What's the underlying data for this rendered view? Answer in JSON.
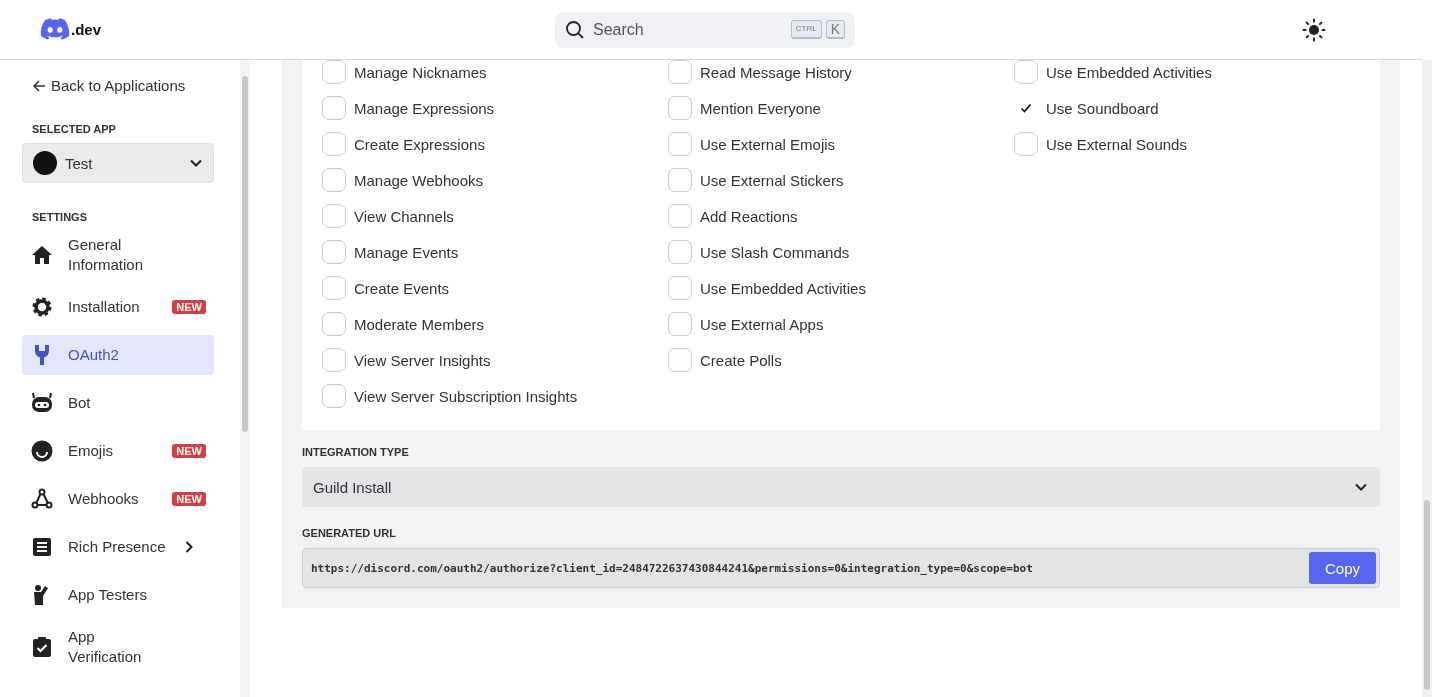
{
  "header": {
    "logo_text": ".dev",
    "search": {
      "placeholder": "Search",
      "shortcut_keys": [
        "CTRL",
        "K"
      ]
    }
  },
  "sidebar": {
    "back_link": "Back to Applications",
    "selected_app_label": "SELECTED APP",
    "selected_app": {
      "name": "Test"
    },
    "settings_label": "SETTINGS",
    "items": [
      {
        "label": "General Information",
        "expandable": false,
        "selected": false
      },
      {
        "label": "Installation",
        "badge": "NEW",
        "expandable": false,
        "selected": false
      },
      {
        "label": "OAuth2",
        "expandable": false,
        "selected": true
      },
      {
        "label": "Bot",
        "expandable": false,
        "selected": false
      },
      {
        "label": "Emojis",
        "badge": "NEW",
        "expandable": false,
        "selected": false
      },
      {
        "label": "Webhooks",
        "badge": "NEW",
        "expandable": false,
        "selected": false
      },
      {
        "label": "Rich Presence",
        "expandable": true,
        "selected": false
      },
      {
        "label": "App Testers",
        "expandable": false,
        "selected": false
      },
      {
        "label": "App Verification",
        "expandable": false,
        "selected": false
      }
    ]
  },
  "permissions": [
    [
      {
        "label": "Manage Nicknames",
        "checked": false
      },
      {
        "label": "Manage Expressions",
        "checked": false
      },
      {
        "label": "Create Expressions",
        "checked": false
      },
      {
        "label": "Manage Webhooks",
        "checked": false
      },
      {
        "label": "View Channels",
        "checked": false
      },
      {
        "label": "Manage Events",
        "checked": false
      },
      {
        "label": "Create Events",
        "checked": false
      },
      {
        "label": "Moderate Members",
        "checked": false
      },
      {
        "label": "View Server Insights",
        "checked": false
      },
      {
        "label": "View Server Subscription Insights",
        "checked": false
      }
    ],
    [
      {
        "label": "Read Message History",
        "checked": false
      },
      {
        "label": "Mention Everyone",
        "checked": false
      },
      {
        "label": "Use External Emojis",
        "checked": false
      },
      {
        "label": "Use External Stickers",
        "checked": false
      },
      {
        "label": "Add Reactions",
        "checked": false
      },
      {
        "label": "Use Slash Commands",
        "checked": false
      },
      {
        "label": "Use Embedded Activities",
        "checked": false
      },
      {
        "label": "Use External Apps",
        "checked": false
      },
      {
        "label": "Create Polls",
        "checked": false
      }
    ],
    [
      {
        "label": "Use Embedded Activities",
        "checked": false
      },
      {
        "label": "Use Soundboard",
        "checked": true
      },
      {
        "label": "Use External Sounds",
        "checked": false
      }
    ]
  ],
  "integration_type": {
    "label": "INTEGRATION TYPE",
    "value": "Guild Install"
  },
  "generated_url": {
    "label": "GENERATED URL",
    "value": "https://discord.com/oauth2/authorize?client_id=2484722637430844241&permissions=0&integration_type=0&scope=bot",
    "button": "Copy"
  }
}
